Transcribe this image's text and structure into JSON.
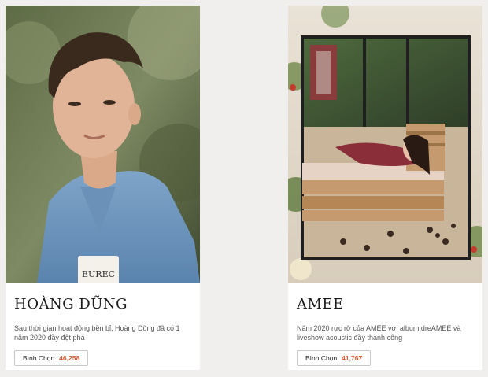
{
  "cards": [
    {
      "name": "HOÀNG DŨNG",
      "description": "Sau thời gian hoạt động bền bỉ, Hoàng Dũng đã có 1 năm 2020 đầy đột phá",
      "vote_label": "Bình Chọn",
      "vote_count": "46,258",
      "photo_text": "EUREC"
    },
    {
      "name": "AMEE",
      "description": "Năm 2020 rực rỡ của AMEE với album dreAMEE và liveshow acoustic đầy thành công",
      "vote_label": "Bình Chọn",
      "vote_count": "41,767"
    }
  ],
  "colors": {
    "accent": "#e4572e",
    "background": "#f0efed",
    "card": "#ffffff"
  }
}
